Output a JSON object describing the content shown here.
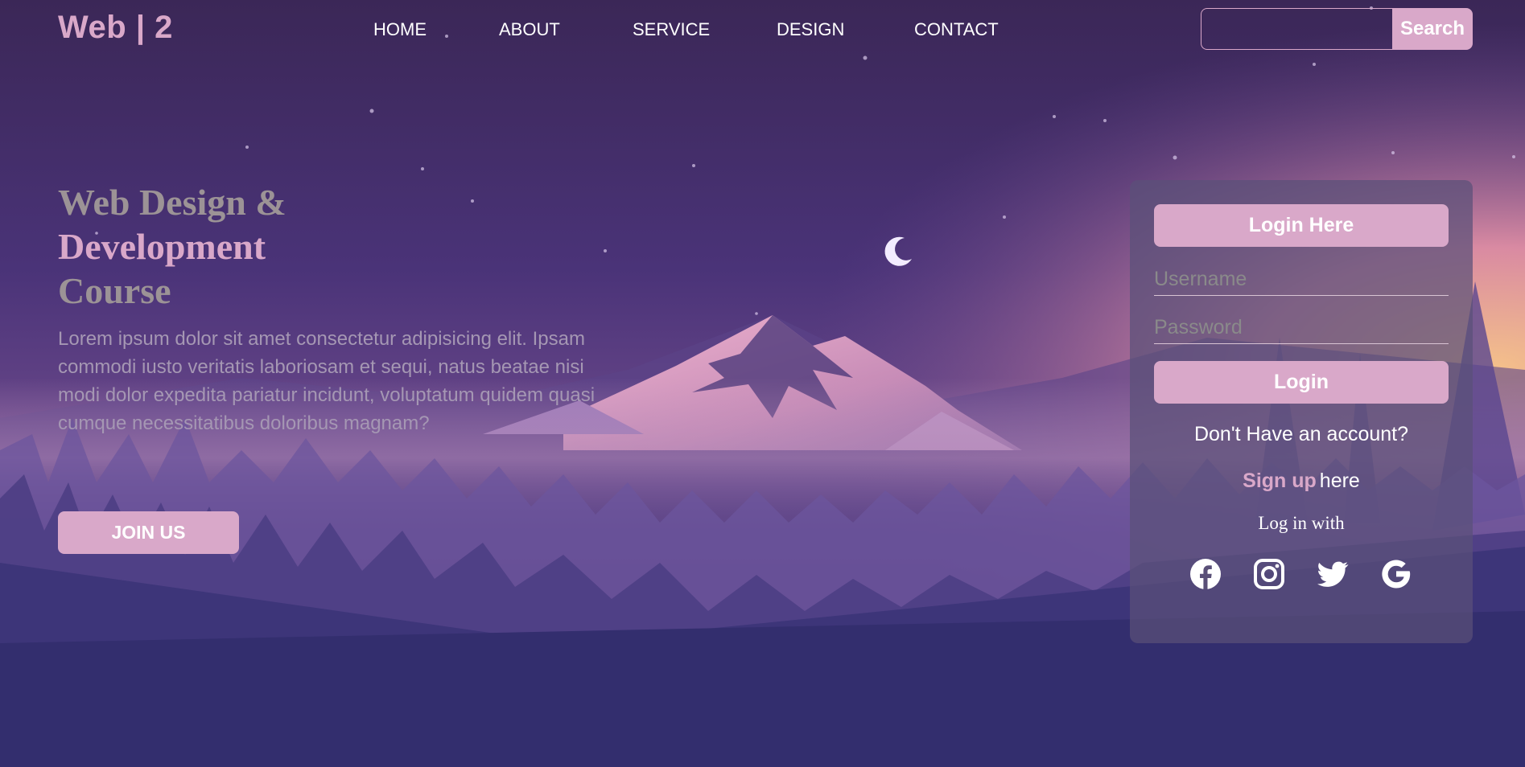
{
  "header": {
    "logo": "Web | 2",
    "nav": [
      "HOME",
      "ABOUT",
      "SERVICE",
      "DESIGN",
      "CONTACT"
    ],
    "search": {
      "placeholder": "",
      "button_label": "Search"
    }
  },
  "hero": {
    "title_line1": "Web Design &",
    "title_line2": "Development",
    "title_line3": "Course",
    "body": "Lorem ipsum dolor sit amet consectetur adipisicing elit. Ipsam commodi iusto veritatis laboriosam et sequi, natus beatae nisi modi dolor expedita pariatur incidunt, voluptatum quidem quasi cumque necessitatibus doloribus magnam?",
    "join_label": "JOIN US"
  },
  "login": {
    "title": "Login Here",
    "username_placeholder": "Username",
    "password_placeholder": "Password",
    "login_label": "Login",
    "no_account": "Don't Have an account?",
    "signup_link": "Sign up",
    "signup_suffix": "here",
    "login_with": "Log in with",
    "social_icons": [
      "facebook-icon",
      "instagram-icon",
      "twitter-icon",
      "google-icon"
    ]
  },
  "colors": {
    "accent": "#d9a8c9",
    "background": "#3a2c63",
    "card": "#5a5078"
  }
}
